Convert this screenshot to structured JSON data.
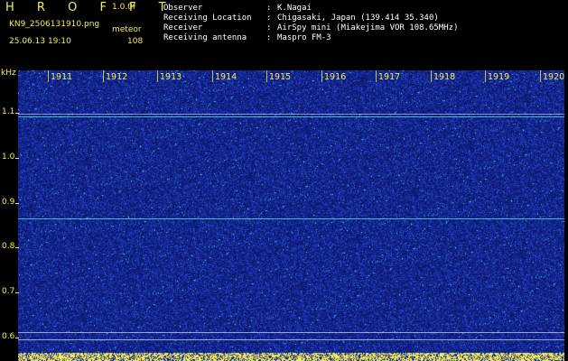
{
  "header": {
    "logo": "H R O F F T",
    "version": "1.0.0f",
    "filename": "KN9_2506131910.png",
    "mode": "meteor",
    "datetime": "25.06.13 19:10",
    "count": "108"
  },
  "meta": [
    {
      "label": "Observer",
      "sep": ":",
      "value": "K.Nagai"
    },
    {
      "label": "Receiving Location",
      "sep": ":",
      "value": "Chigasaki, Japan (139.414 35.340)"
    },
    {
      "label": "Receiver",
      "sep": ":",
      "value": "AirSpy mini (Miakejima VOR 108.65MHz)"
    },
    {
      "label": "Receiving antenna",
      "sep": ":",
      "value": "Maspro FM-3"
    }
  ],
  "spectrogram": {
    "y_unit": "kHz",
    "y_labels": [
      "1.1",
      "1.0",
      "0.9",
      "0.8",
      "0.7",
      "0.6"
    ],
    "x_labels": [
      "1911",
      "1912",
      "1913",
      "1914",
      "1915",
      "1916",
      "1917",
      "1918",
      "1919",
      "1920"
    ],
    "colors": {
      "background": "#0b1a6e",
      "noise_dim": "#2a3fb8",
      "noise_bright": "#3fd6e0",
      "trace": "#4fd6c8",
      "axis_text": "#f2ee5a",
      "footer_bar": "#f2ee5a"
    }
  }
}
